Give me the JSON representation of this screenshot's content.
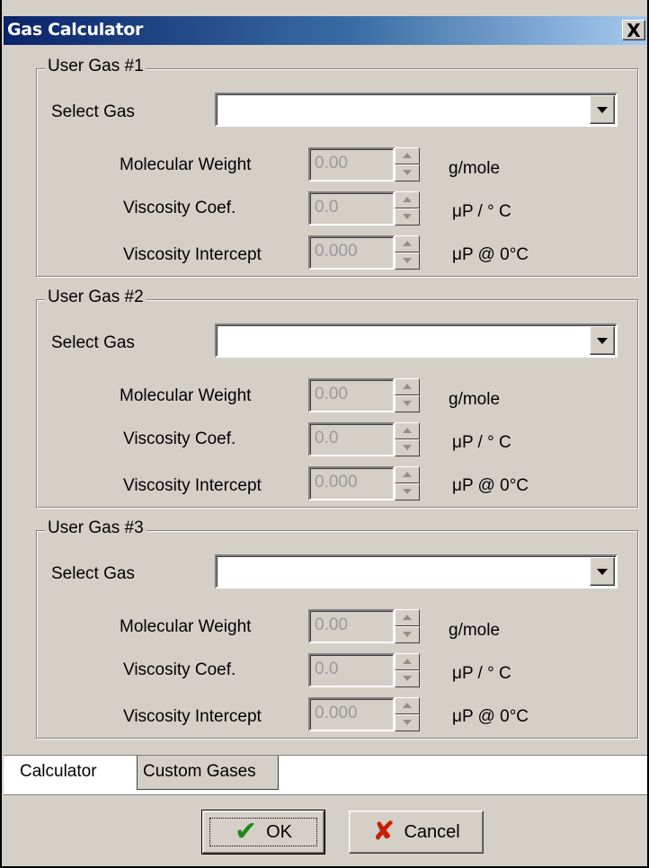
{
  "window": {
    "title": "Gas Calculator",
    "close_label": "X"
  },
  "groups": [
    {
      "legend": "User Gas #1",
      "select_label": "Select Gas",
      "selected_gas": "",
      "rows": [
        {
          "label": "Molecular  Weight",
          "value": "0.00",
          "unit": "g/mole"
        },
        {
          "label": "Viscosity Coef.",
          "value": "0.0",
          "unit": "μP / ° C"
        },
        {
          "label": "Viscosity Intercept",
          "value": "0.000",
          "unit": "μP @ 0°C"
        }
      ]
    },
    {
      "legend": "User Gas #2",
      "select_label": "Select Gas",
      "selected_gas": "",
      "rows": [
        {
          "label": "Molecular  Weight",
          "value": "0.00",
          "unit": "g/mole"
        },
        {
          "label": "Viscosity Coef.",
          "value": "0.0",
          "unit": "μP / ° C"
        },
        {
          "label": "Viscosity Intercept",
          "value": "0.000",
          "unit": "μP @ 0°C"
        }
      ]
    },
    {
      "legend": "User Gas #3",
      "select_label": "Select Gas",
      "selected_gas": "",
      "rows": [
        {
          "label": "Molecular  Weight",
          "value": "0.00",
          "unit": "g/mole"
        },
        {
          "label": "Viscosity Coef.",
          "value": "0.0",
          "unit": "μP / ° C"
        },
        {
          "label": "Viscosity Intercept",
          "value": "0.000",
          "unit": "μP @ 0°C"
        }
      ]
    }
  ],
  "tabs": [
    {
      "label": "Calculator",
      "active": true
    },
    {
      "label": "Custom Gases",
      "active": false
    }
  ],
  "buttons": {
    "ok_label": "OK",
    "cancel_label": "Cancel",
    "ok_icon": "checkmark-icon",
    "cancel_icon": "x-icon"
  },
  "colors": {
    "title_gradient_start": "#0a246a",
    "title_gradient_end": "#a6caf0",
    "face": "#d4d0c8",
    "check_green": "#1e8a14",
    "cancel_red": "#c81e00"
  }
}
